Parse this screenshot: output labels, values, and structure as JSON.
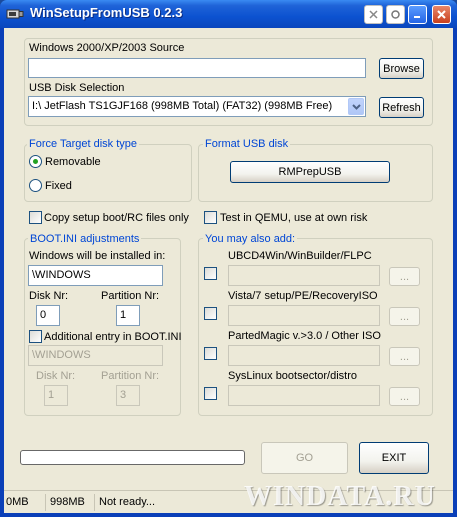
{
  "window": {
    "title": "WinSetupFromUSB 0.2.3"
  },
  "source": {
    "label": "Windows 2000/XP/2003 Source",
    "value": "",
    "browse_label": "Browse"
  },
  "usb": {
    "label": "USB Disk Selection",
    "selected": "I:\\ JetFlash TS1GJF168 (998MB Total) (FAT32) (998MB Free)",
    "refresh_label": "Refresh"
  },
  "force_target": {
    "title": "Force Target disk type",
    "removable_label": "Removable",
    "fixed_label": "Fixed",
    "selected": "Removable"
  },
  "format_usb": {
    "title": "Format USB disk",
    "rmprep_label": "RMPrepUSB"
  },
  "options": {
    "copy_setup_label": "Copy setup boot/RC files only",
    "test_qemu_label": "Test in QEMU, use at own risk"
  },
  "boot_ini": {
    "title": "BOOT.INI adjustments",
    "install_label": "Windows will be installed in:",
    "install_value": "\\WINDOWS",
    "disk_nr_label": "Disk Nr:",
    "disk_nr_value": "0",
    "partition_nr_label": "Partition Nr:",
    "partition_nr_value": "1",
    "additional_label": "Additional entry in BOOT.INI",
    "additional_value": "\\WINDOWS",
    "disk_nr2_label": "Disk Nr:",
    "disk_nr2_value": "1",
    "partition_nr2_label": "Partition Nr:",
    "partition_nr2_value": "3"
  },
  "also_add": {
    "title": "You may also add:",
    "items": [
      {
        "label": "UBCD4Win/WinBuilder/FLPC",
        "value": "",
        "browse": "..."
      },
      {
        "label": "Vista/7 setup/PE/RecoveryISO",
        "value": "",
        "browse": "..."
      },
      {
        "label": "PartedMagic v.>3.0 / Other ISO",
        "value": "",
        "browse": "..."
      },
      {
        "label": "SysLinux bootsector/distro",
        "value": "",
        "browse": "..."
      }
    ]
  },
  "actions": {
    "go_label": "GO",
    "exit_label": "EXIT",
    "progress": 0
  },
  "status": {
    "used": "0MB",
    "total": "998MB",
    "message": "Not ready..."
  },
  "watermark": "WINDATA.RU",
  "colors": {
    "titlebar": "#0c52d0",
    "group_title": "#0046d5",
    "client_bg": "#ece9d8"
  }
}
